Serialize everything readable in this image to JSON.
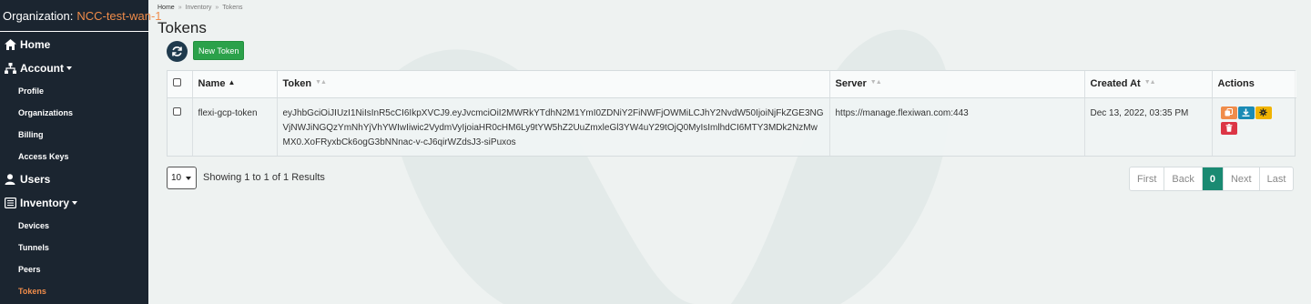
{
  "sidebar": {
    "org_label": "Organization:",
    "org_name": "NCC-test-wan-1",
    "home": "Home",
    "account": "Account",
    "account_items": [
      "Profile",
      "Organizations",
      "Billing",
      "Access Keys"
    ],
    "users": "Users",
    "inventory": "Inventory",
    "inventory_items": [
      "Devices",
      "Tunnels",
      "Peers",
      "Tokens"
    ]
  },
  "breadcrumb": [
    "Home",
    "Inventory",
    "Tokens"
  ],
  "page_title": "Tokens",
  "toolbar": {
    "new_token": "New Token"
  },
  "table": {
    "headers": [
      "Name",
      "Token",
      "Server",
      "Created At",
      "Actions"
    ],
    "rows": [
      {
        "name": "flexi-gcp-token",
        "token": "eyJhbGciOiJIUzI1NiIsInR5cCI6IkpXVCJ9.eyJvcmciOiI2MWRkYTdhN2M1YmI0ZDNiY2FiNWFjOWMiLCJhY2NvdW50IjoiNjFkZGE3NGVjNWJiNGQzYmNhYjVhYWIwIiwic2VydmVyIjoiaHR0cHM6Ly9tYW5hZ2UuZmxleGl3YW4uY29tOjQ0MyIsImlhdCI6MTY3MDk2NzMwMX0.XoFRyxbCk6ogG3bNNnac-v-cJ6qirWZdsJ3-siPuxos",
        "server": "https://manage.flexiwan.com:443",
        "created_at": "Dec 13, 2022, 03:35 PM"
      }
    ]
  },
  "footer": {
    "page_size": "10",
    "showing": "Showing 1 to 1 of 1 Results",
    "pager": {
      "first": "First",
      "back": "Back",
      "current": "0",
      "next": "Next",
      "last": "Last"
    }
  },
  "colors": {
    "sidebar_bg": "#1b2530",
    "accent_orange": "#f08c4a",
    "new_btn": "#2ba14a",
    "pager_active": "#1a8a72"
  }
}
